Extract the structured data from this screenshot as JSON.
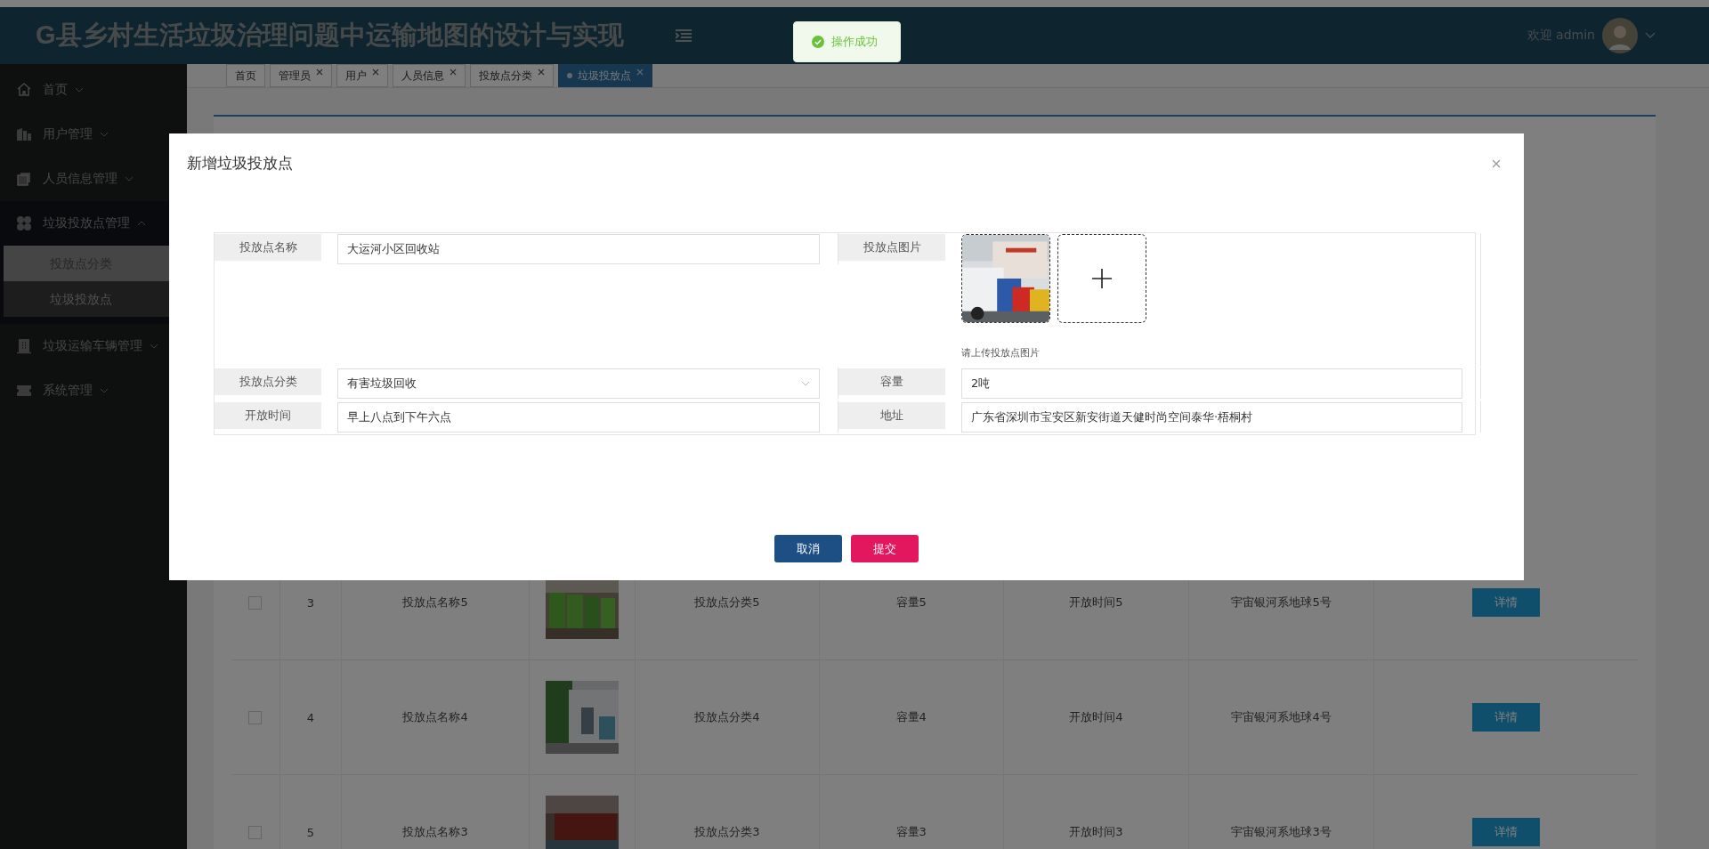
{
  "header": {
    "title": "G县乡村生活垃圾治理问题中运输地图的设计与实现",
    "greeting": "欢迎 admin"
  },
  "toast": {
    "message": "操作成功"
  },
  "sidebar": {
    "items": [
      {
        "label": "首页",
        "expanded": false
      },
      {
        "label": "用户管理",
        "expanded": false
      },
      {
        "label": "人员信息管理",
        "expanded": false
      },
      {
        "label": "垃圾投放点管理",
        "expanded": true,
        "children": [
          {
            "label": "投放点分类",
            "selected": false
          },
          {
            "label": "垃圾投放点",
            "selected": true
          }
        ]
      },
      {
        "label": "垃圾运输车辆管理",
        "expanded": false
      },
      {
        "label": "系统管理",
        "expanded": false
      }
    ]
  },
  "tabs": [
    {
      "label": "首页",
      "closable": false,
      "selected": false
    },
    {
      "label": "管理员",
      "closable": true,
      "selected": false
    },
    {
      "label": "用户",
      "closable": true,
      "selected": false
    },
    {
      "label": "人员信息",
      "closable": true,
      "selected": false
    },
    {
      "label": "投放点分类",
      "closable": true,
      "selected": false
    },
    {
      "label": "垃圾投放点",
      "closable": true,
      "selected": true
    }
  ],
  "table": {
    "rows": [
      {
        "checked": false,
        "index": "3",
        "name": "投放点名称5",
        "category": "投放点分类5",
        "capacity": "容量5",
        "open_time": "开放时间5",
        "address": "宇宙银河系地球5号",
        "action": "详情"
      },
      {
        "checked": false,
        "index": "4",
        "name": "投放点名称4",
        "category": "投放点分类4",
        "capacity": "容量4",
        "open_time": "开放时间4",
        "address": "宇宙银河系地球4号",
        "action": "详情"
      },
      {
        "checked": false,
        "index": "5",
        "name": "投放点名称3",
        "category": "投放点分类3",
        "capacity": "容量3",
        "open_time": "开放时间3",
        "address": "宇宙银河系地球3号",
        "action": "详情"
      }
    ]
  },
  "dialog": {
    "title": "新增垃圾投放点",
    "fields": [
      {
        "kind": "text",
        "label": "投放点名称",
        "value": "大运河小区回收站"
      },
      {
        "label": "投放点图片",
        "hint": "请上传投放点图片"
      },
      {
        "kind": "select",
        "label": "投放点分类",
        "value": "有害垃圾回收"
      },
      {
        "kind": "text",
        "label": "容量",
        "value": "2吨"
      },
      {
        "kind": "text",
        "label": "开放时间",
        "value": "早上八点到下午六点"
      },
      {
        "kind": "text",
        "label": "地址",
        "value": "广东省深圳市宝安区新安街道天健时尚空间泰华·梧桐村"
      }
    ],
    "buttons": [
      {
        "kind": "cancel",
        "label": "取消"
      },
      {
        "kind": "submit",
        "label": "提交"
      }
    ]
  }
}
